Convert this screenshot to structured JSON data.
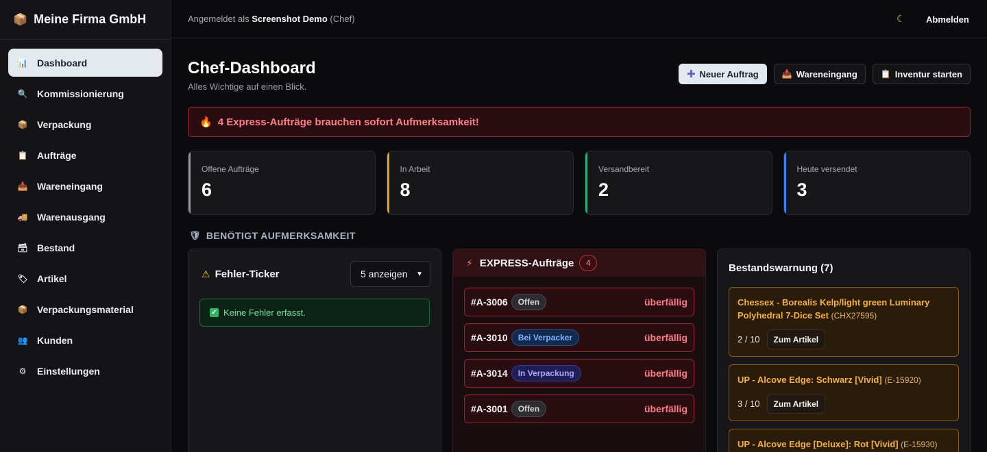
{
  "brand": {
    "icon": "📦",
    "name": "Meine Firma GmbH"
  },
  "sidebar": {
    "items": [
      {
        "icon": "📊",
        "label": "Dashboard",
        "active": true
      },
      {
        "icon": "🔍",
        "label": "Kommissionierung"
      },
      {
        "icon": "📦",
        "label": "Verpackung"
      },
      {
        "icon": "📋",
        "label": "Aufträge"
      },
      {
        "icon": "📥",
        "label": "Wareneingang"
      },
      {
        "icon": "🚚",
        "label": "Warenausgang"
      },
      {
        "icon": "🗃",
        "label": "Bestand"
      },
      {
        "icon": "🏷",
        "label": "Artikel"
      },
      {
        "icon": "📦",
        "label": "Verpackungsmaterial"
      },
      {
        "icon": "👥",
        "label": "Kunden"
      },
      {
        "icon": "⚙",
        "label": "Einstellungen"
      }
    ]
  },
  "topbar": {
    "login_prefix": "Angemeldet als",
    "user": "Screenshot Demo",
    "role": "(Chef)",
    "theme_icon": "☾",
    "logout": "Abmelden"
  },
  "page": {
    "title": "Chef-Dashboard",
    "subtitle": "Alles Wichtige auf einen Blick."
  },
  "actions": {
    "new_order": {
      "icon": "✚",
      "label": "Neuer Auftrag"
    },
    "goods_in": {
      "icon": "📥",
      "label": "Wareneingang"
    },
    "inventory": {
      "icon": "📋",
      "label": "Inventur starten"
    }
  },
  "alert": {
    "icon": "🔥",
    "text": "4 Express-Aufträge brauchen sofort Aufmerksamkeit!"
  },
  "stats": [
    {
      "label": "Offene Aufträge",
      "value": "6",
      "color": "#8f97a3"
    },
    {
      "label": "In Arbeit",
      "value": "8",
      "color": "#f0a020"
    },
    {
      "label": "Versandbereit",
      "value": "2",
      "color": "#22b07d"
    },
    {
      "label": "Heute versendet",
      "value": "3",
      "color": "#3b82f6"
    }
  ],
  "section": {
    "icon": "🛡",
    "title": "BENÖTIGT AUFMERKSAMKEIT"
  },
  "error_ticker": {
    "icon": "⚠",
    "title": "Fehler-Ticker",
    "select_value": "5 anzeigen",
    "ok_icon": "✔",
    "ok_text": "Keine Fehler erfasst."
  },
  "express": {
    "icon": "⚡",
    "title": "EXPRESS-Aufträge",
    "count": "4",
    "orders": [
      {
        "number": "#A-3006",
        "status": "Offen",
        "status_kind": "offen",
        "flag": "überfällig"
      },
      {
        "number": "#A-3010",
        "status": "Bei Verpacker",
        "status_kind": "verpacker",
        "flag": "überfällig"
      },
      {
        "number": "#A-3014",
        "status": "In Verpackung",
        "status_kind": "verpackung",
        "flag": "überfällig"
      },
      {
        "number": "#A-3001",
        "status": "Offen",
        "status_kind": "offen",
        "flag": "überfällig"
      }
    ]
  },
  "stock_warning": {
    "title": "Bestandswarnung (7)",
    "items": [
      {
        "name": "Chessex - Borealis Kelp/light green Luminary Polyhedral 7-Dice Set",
        "sku": "(CHX27595)",
        "qty": "2 / 10",
        "button": "Zum Artikel"
      },
      {
        "name": "UP - Alcove Edge: Schwarz [Vivid]",
        "sku": "(E-15920)",
        "qty": "3 / 10",
        "button": "Zum Artikel"
      },
      {
        "name": "UP - Alcove Edge [Deluxe]: Rot [Vivid]",
        "sku": "(E-15930)",
        "qty": "",
        "button": ""
      }
    ]
  }
}
